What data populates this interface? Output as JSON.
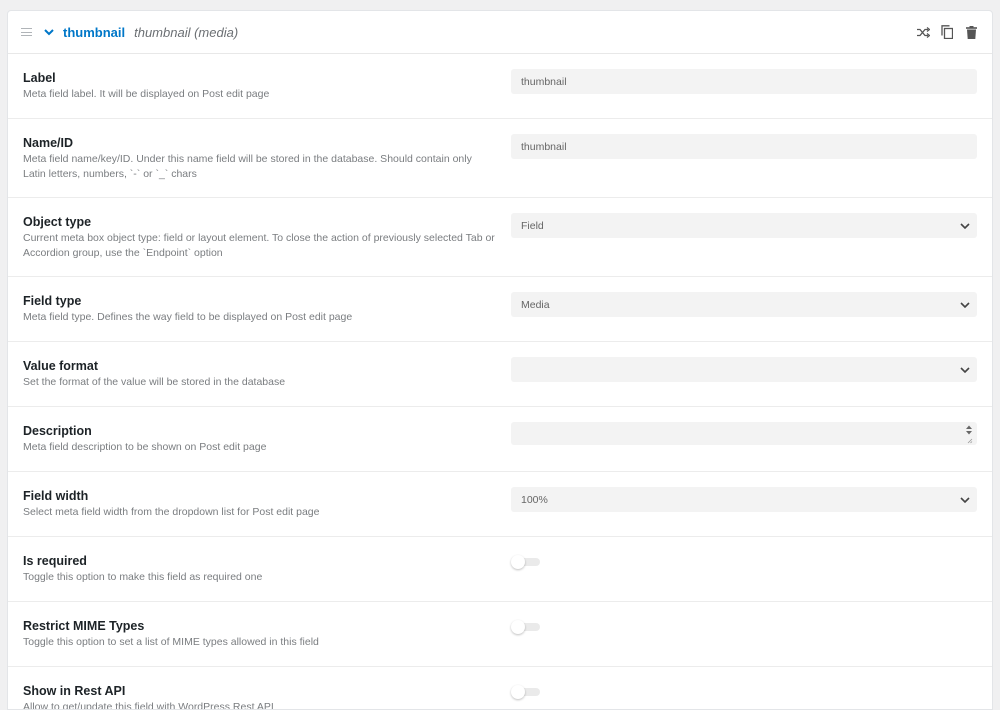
{
  "header": {
    "title": "thumbnail",
    "subtitle": "thumbnail (media)",
    "icons": [
      "drag-handle-icon",
      "chevron-down-icon",
      "shuffle-icon",
      "copy-icon",
      "trash-icon"
    ]
  },
  "rows": {
    "label": {
      "title": "Label",
      "desc": "Meta field label. It will be displayed on Post edit page",
      "value": "thumbnail"
    },
    "name_id": {
      "title": "Name/ID",
      "desc": "Meta field name/key/ID. Under this name field will be stored in the database. Should contain only Latin letters, numbers, `-` or `_` chars",
      "value": "thumbnail"
    },
    "object_type": {
      "title": "Object type",
      "desc": "Current meta box object type: field or layout element. To close the action of previously selected Tab or Accordion group, use the `Endpoint` option",
      "value": "Field"
    },
    "field_type": {
      "title": "Field type",
      "desc": "Meta field type. Defines the way field to be displayed on Post edit page",
      "value": "Media"
    },
    "value_format": {
      "title": "Value format",
      "desc": "Set the format of the value will be stored in the database",
      "value": ""
    },
    "description": {
      "title": "Description",
      "desc": "Meta field description to be shown on Post edit page",
      "value": ""
    },
    "field_width": {
      "title": "Field width",
      "desc": "Select meta field width from the dropdown list for Post edit page",
      "value": "100%"
    },
    "is_required": {
      "title": "Is required",
      "desc": "Toggle this option to make this field as required one",
      "enabled": false
    },
    "restrict_mime": {
      "title": "Restrict MIME Types",
      "desc": "Toggle this option to set a list of MIME types allowed in this field",
      "enabled": false
    },
    "show_rest_api": {
      "title": "Show in Rest API",
      "desc": "Allow to get/update this field with WordPress Rest API",
      "enabled": false
    }
  },
  "colors": {
    "accent": "#0077c8",
    "input_bg": "#f3f3f3",
    "page_bg": "#f0f0f1"
  }
}
